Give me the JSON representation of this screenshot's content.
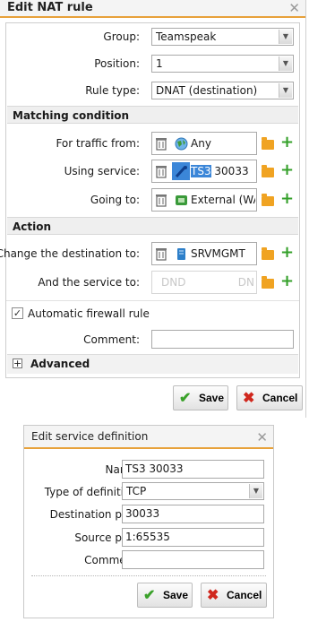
{
  "nat": {
    "title": "Edit NAT rule",
    "group_label": "Group:",
    "group_value": "Teamspeak",
    "position_label": "Position:",
    "position_value": "1",
    "ruletype_label": "Rule type:",
    "ruletype_value": "DNAT (destination)",
    "matching_header": "Matching condition",
    "traffic_from_label": "For traffic from:",
    "traffic_from_value": "Any",
    "using_service_label": "Using service:",
    "using_service_sel": "TS3",
    "using_service_rest": " 30033",
    "going_to_label": "Going to:",
    "going_to_value": "External (WAN",
    "action_header": "Action",
    "change_dest_label": "Change the destination to:",
    "change_dest_value": "SRVMGMT",
    "service_to_label": "And the service to:",
    "service_to_placeholder_left": "DND",
    "service_to_placeholder_right": "DN",
    "auto_fw_label": "Automatic firewall rule",
    "auto_fw_checked": true,
    "comment_label": "Comment:",
    "comment_value": "",
    "advanced_label": "Advanced",
    "save_label": "Save",
    "cancel_label": "Cancel"
  },
  "service": {
    "title": "Edit service definition",
    "name_label": "Name:",
    "name_value": "TS3 30033",
    "type_label": "Type of definition:",
    "type_value": "TCP",
    "dest_port_label": "Destination port:",
    "dest_port_value": "30033",
    "src_port_label": "Source port:",
    "src_port_value": "1:65535",
    "comment_label": "Comment:",
    "comment_value": "",
    "save_label": "Save",
    "cancel_label": "Cancel"
  },
  "colors": {
    "accent": "#e7a13a",
    "save_check": "#3aa12a",
    "cancel_x": "#d0271d",
    "selection": "#3b86d8",
    "plus": "#34a02a"
  },
  "icons": [
    "close-icon",
    "trash-icon",
    "globe-icon",
    "service-icon",
    "network-icon",
    "server-icon",
    "folder-icon",
    "plus-icon",
    "check-icon",
    "x-icon",
    "expand-icon"
  ]
}
